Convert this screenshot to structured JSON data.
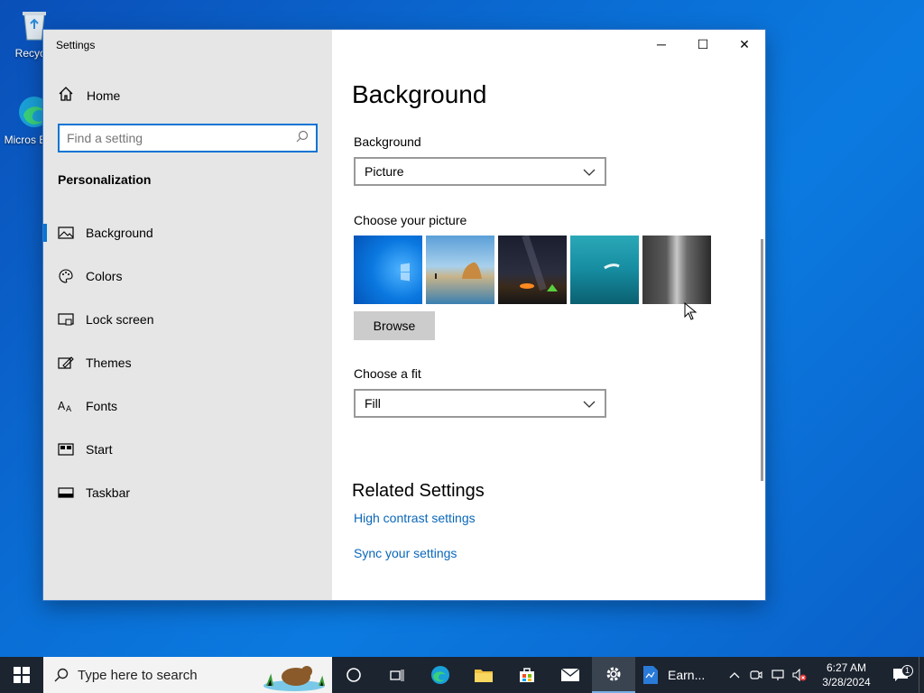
{
  "desktop": {
    "icons": [
      {
        "label": "Recycle",
        "icon": "recycle-bin-icon"
      },
      {
        "label": "Micros Edge",
        "icon": "edge-icon"
      }
    ]
  },
  "window": {
    "title": "Settings",
    "controls": {
      "minimize": "─",
      "maximize": "☐",
      "close": "✕"
    }
  },
  "sidebar": {
    "home_label": "Home",
    "search_placeholder": "Find a setting",
    "section_title": "Personalization",
    "items": [
      {
        "label": "Background",
        "icon": "picture-icon",
        "active": true
      },
      {
        "label": "Colors",
        "icon": "palette-icon",
        "active": false
      },
      {
        "label": "Lock screen",
        "icon": "lock-screen-icon",
        "active": false
      },
      {
        "label": "Themes",
        "icon": "themes-icon",
        "active": false
      },
      {
        "label": "Fonts",
        "icon": "fonts-icon",
        "active": false
      },
      {
        "label": "Start",
        "icon": "start-icon",
        "active": false
      },
      {
        "label": "Taskbar",
        "icon": "taskbar-icon",
        "active": false
      }
    ]
  },
  "main": {
    "page_title": "Background",
    "background_label": "Background",
    "background_value": "Picture",
    "choose_picture_label": "Choose your picture",
    "browse_label": "Browse",
    "fit_label": "Choose a fit",
    "fit_value": "Fill",
    "related_title": "Related Settings",
    "links": [
      "High contrast settings",
      "Sync your settings"
    ]
  },
  "taskbar": {
    "search_placeholder": "Type here to search",
    "app_label": "Earn...",
    "time": "6:27 AM",
    "date": "3/28/2024",
    "notification_count": "1"
  },
  "colors": {
    "accent": "#0a74d3",
    "link": "#0a67b8",
    "sidebar_bg": "#e6e6e6",
    "taskbar_bg": "#1c2430"
  }
}
